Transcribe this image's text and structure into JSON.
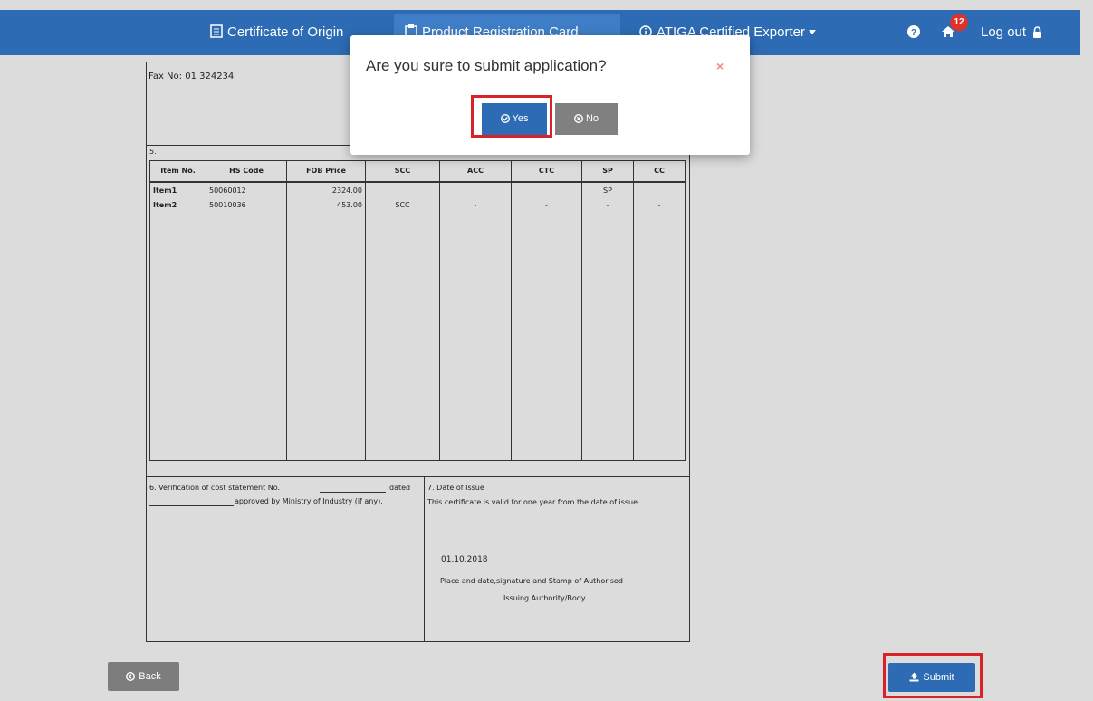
{
  "navbar": {
    "certificate_of_origin": "Certificate of Origin",
    "product_registration_card": "Product Registration Card",
    "atiga_certified_exporter": "ATIGA Certified Exporter",
    "notifications_count": "12",
    "logout": "Log out",
    "icons": [
      "certificate-icon",
      "registration-icon",
      "info-circle-icon",
      "caret-down-icon",
      "help-icon",
      "home-icon",
      "lock-icon"
    ]
  },
  "form": {
    "fax": "Fax No: 01 324234",
    "section5": "5.",
    "columns": [
      "Item No.",
      "HS Code",
      "FOB Price",
      "SCC",
      "ACC",
      "CTC",
      "SP",
      "CC"
    ],
    "rows": [
      {
        "item": "Item1",
        "hs": "50060012",
        "fob": "2324.00",
        "scc": "",
        "acc": "",
        "ctc": "",
        "sp": "SP",
        "cc": ""
      },
      {
        "item": "Item2",
        "hs": "50010036",
        "fob": "453.00",
        "scc": "SCC",
        "acc": "-",
        "ctc": "-",
        "sp": "-",
        "cc": "-"
      }
    ],
    "section6_line1": "6. Verification of cost statement No.",
    "section6_dated": "dated",
    "section6_line2": "approved by Ministry of Industry (if any).",
    "section7_title": "7. Date of Issue",
    "section7_text": "This certificate is valid for one year from the date of issue.",
    "issue_date": "01.10.2018",
    "signature_line1": "Place and date,signature and Stamp of Authorised",
    "signature_line2": "Issuing Authority/Body"
  },
  "buttons": {
    "back": "Back",
    "submit": "Submit"
  },
  "modal": {
    "title": "Are you sure to submit application?",
    "close": "×",
    "yes": "Yes",
    "no": "No"
  },
  "colors": {
    "navbar": "#2d6bb4",
    "highlight": "#d8232a",
    "badge": "#e0312b"
  }
}
